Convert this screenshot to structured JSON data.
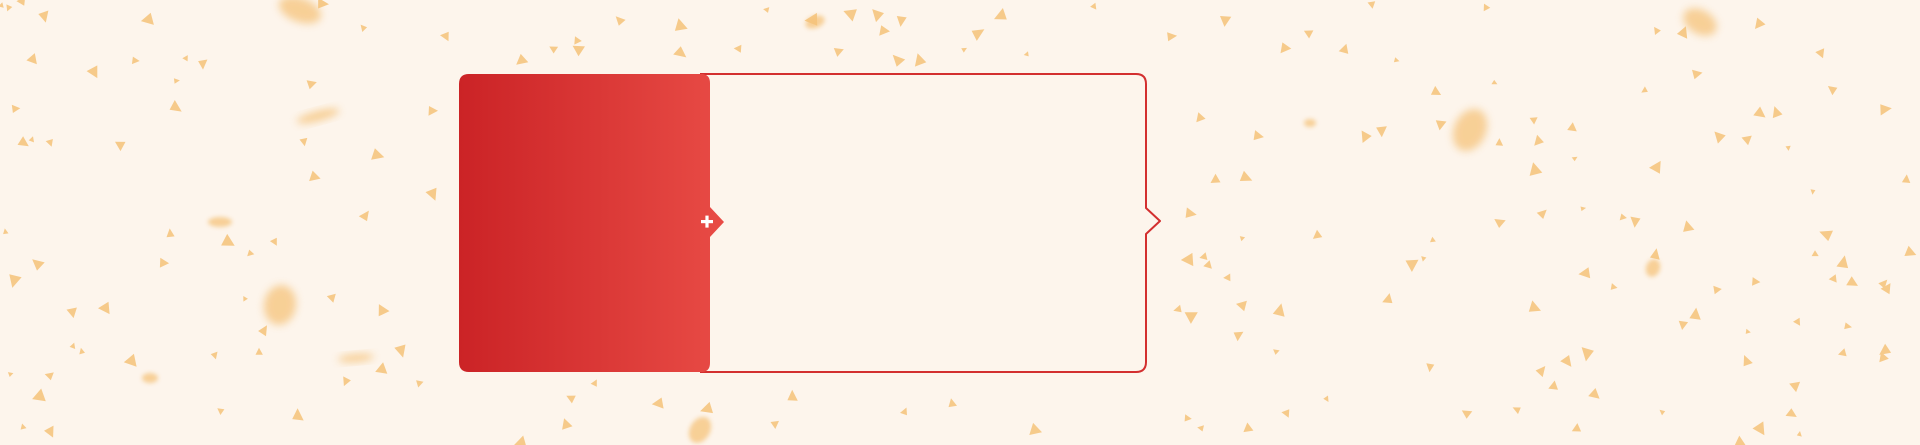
{
  "colors": {
    "background": "#fdf5ec",
    "accent": "#d32f2f",
    "gradient_start": "#cc2427",
    "gradient_end": "#e84b45",
    "panel_fill": "#fdf5ec",
    "confetti": "#f5c37a",
    "icon": "#ffffff"
  },
  "card": {
    "left_panel": {
      "label": ""
    },
    "right_panel": {
      "label": ""
    },
    "connector_icon": "plus-icon"
  }
}
